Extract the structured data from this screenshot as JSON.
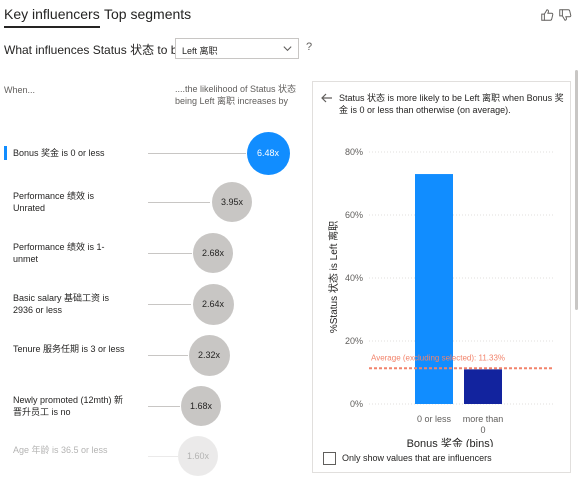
{
  "tabs": {
    "key_influencers": "Key influencers",
    "top_segments": "Top segments"
  },
  "header_icons": [
    "thumbs-up-icon",
    "thumbs-down-icon"
  ],
  "question": {
    "text": "What influences Status 状态 to be",
    "selected": "Left 离职",
    "help": "?"
  },
  "columns": {
    "when": "When...",
    "likelihood": "....the likelihood of Status 状态 being Left 离职 increases by"
  },
  "influencers": [
    {
      "label": "Bonus 奖金 is 0 or less",
      "value": "6.48x"
    },
    {
      "label": "Performance 绩效 is Unrated",
      "value": "3.95x"
    },
    {
      "label": "Performance 绩效 is 1-unmet",
      "value": "2.68x"
    },
    {
      "label": "Basic salary 基础工资 is 2936 or less",
      "value": "2.64x"
    },
    {
      "label": "Tenure 服务任期 is 3 or less",
      "value": "2.32x"
    },
    {
      "label": "Newly promoted (12mth) 新晋升员工 is no",
      "value": "1.68x"
    },
    {
      "label": "Age 年龄 is 36.5 or less",
      "value": "1.60x"
    }
  ],
  "panel": {
    "title": "Status 状态 is more likely to be Left 离职 when Bonus 奖金 is 0 or less than otherwise (on average).",
    "checkbox_label": "Only show values that are influencers"
  },
  "colors": {
    "accent": "#118dff",
    "dark_bar": "#12239e",
    "avg_line": "#f2836b",
    "bubble": "#c8c6c4"
  },
  "chart_data": {
    "type": "bar",
    "categories": [
      "0 or less",
      "more than 0"
    ],
    "values": [
      73,
      11
    ],
    "ylabel": "%Status 状态 is Left 离职",
    "xlabel": "Bonus 奖金 (bins)",
    "yticks": [
      "0%",
      "20%",
      "40%",
      "60%",
      "80%"
    ],
    "ylim": [
      0,
      80
    ],
    "average": {
      "value": 11.33,
      "label": "Average (excluding selected): 11.33%"
    }
  }
}
